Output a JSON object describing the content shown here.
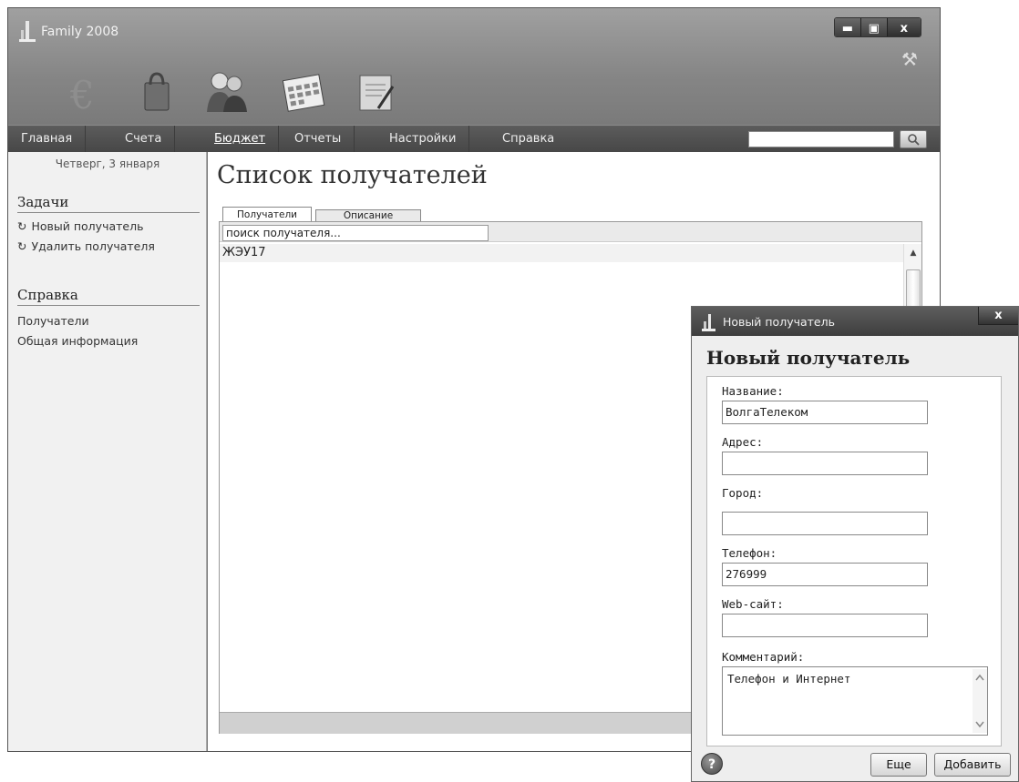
{
  "app": {
    "title": "Family 2008",
    "min": "▬",
    "max": "▣",
    "close": "x"
  },
  "nav": {
    "items": [
      "Главная",
      "Счета",
      "Бюджет",
      "Отчеты",
      "Настройки",
      "Справка"
    ]
  },
  "sidebar": {
    "date": "Четверг, 3 января",
    "tasks_title": "Задачи",
    "tasks": [
      "Новый получатель",
      "Удалить получателя"
    ],
    "help_title": "Справка",
    "help": [
      "Получатели",
      "Общая информация"
    ]
  },
  "main": {
    "title": "Список получателей",
    "tabs": [
      "Получатели",
      "Описание"
    ],
    "search_value": "поиск получателя...",
    "rows": [
      "ЖЭУ17"
    ]
  },
  "dialog": {
    "window_title": "Новый получатель",
    "close": "x",
    "heading": "Новый получатель",
    "fields": [
      {
        "label": "Название:",
        "value": "ВолгаТелеком"
      },
      {
        "label": "Адрес:",
        "value": ""
      },
      {
        "label": "Город:",
        "value": ""
      },
      {
        "label": "Телефон:",
        "value": "276999"
      },
      {
        "label": "Web-сайт:",
        "value": ""
      }
    ],
    "comment_label": "Комментарий:",
    "comment_value": "Телефон и Интернет",
    "help": "?",
    "more_button": "Еще",
    "add_button": "Добавить"
  }
}
